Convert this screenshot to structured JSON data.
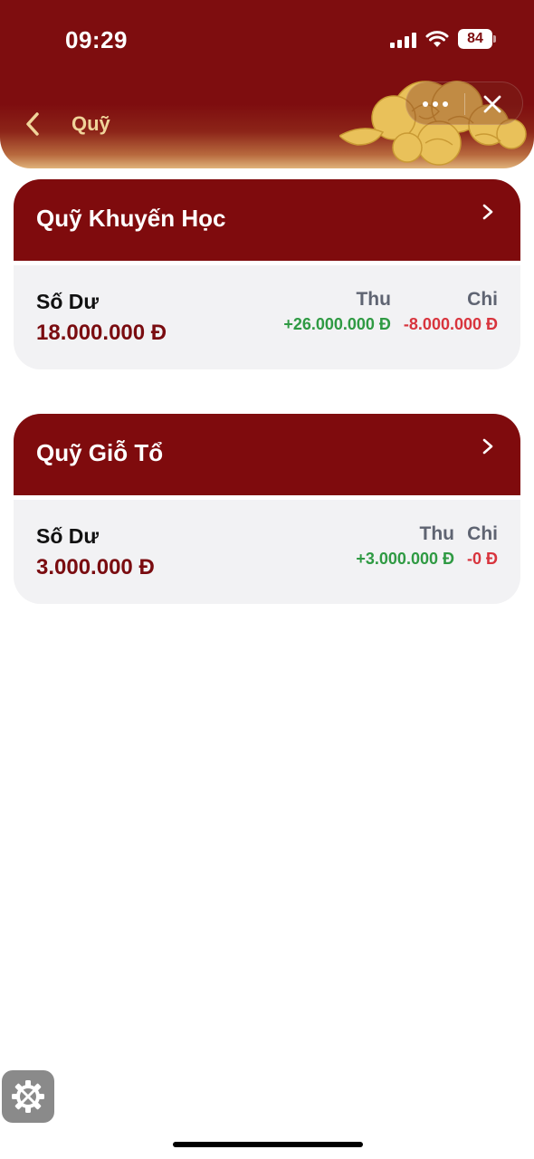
{
  "status_bar": {
    "time": "09:29",
    "battery": "84"
  },
  "header": {
    "title": "Quỹ"
  },
  "funds": [
    {
      "name": "Quỹ Khuyến Học",
      "balance_label": "Số Dư",
      "balance": "18.000.000 Đ",
      "income_label": "Thu",
      "income": "+26.000.000 Đ",
      "expense_label": "Chi",
      "expense": "-8.000.000 Đ"
    },
    {
      "name": "Quỹ Giỗ Tổ",
      "balance_label": "Số Dư",
      "balance": "3.000.000 Đ",
      "income_label": "Thu",
      "income": "+3.000.000 Đ",
      "expense_label": "Chi",
      "expense": "-0 Đ"
    }
  ],
  "icons": {
    "back": "chevron-left-icon",
    "more": "more-dots-icon",
    "close": "close-icon",
    "card_arrow": "chevron-right-icon",
    "settings": "settings-gear-icon",
    "decoration": "cloud-decoration"
  },
  "colors": {
    "brand": "#7f0b0d",
    "accent_gold": "#f0d49a",
    "income": "#2f9a43",
    "expense": "#d8343d"
  }
}
